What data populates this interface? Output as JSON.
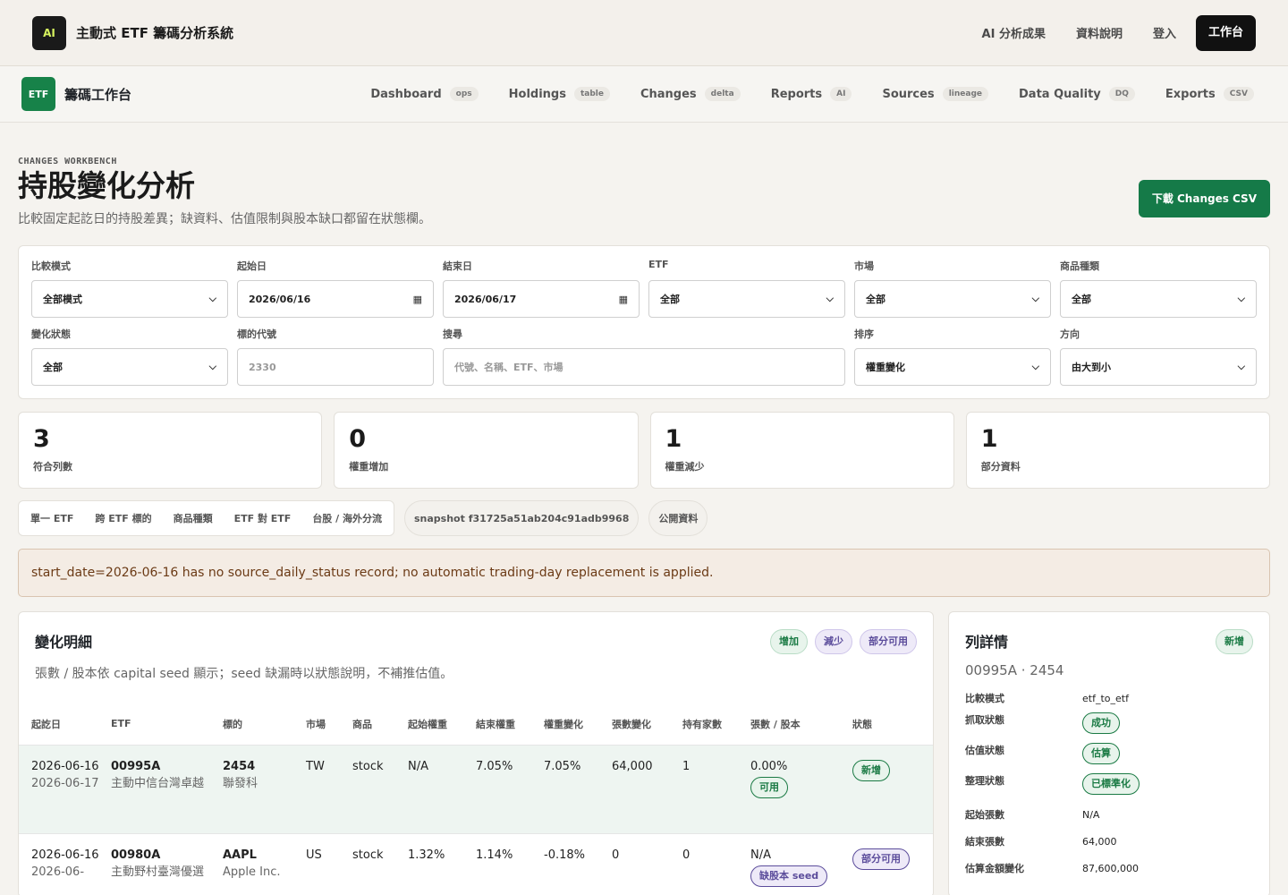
{
  "topbar": {
    "logo": "AI",
    "title": "主動式 ETF 籌碼分析系統",
    "links": [
      "AI 分析成果",
      "資料說明",
      "登入"
    ],
    "workspace_button": "工作台"
  },
  "subbar": {
    "logo": "ETF",
    "title": "籌碼工作台",
    "nav": [
      {
        "label": "Dashboard",
        "tag": "ops"
      },
      {
        "label": "Holdings",
        "tag": "table"
      },
      {
        "label": "Changes",
        "tag": "delta"
      },
      {
        "label": "Reports",
        "tag": "AI"
      },
      {
        "label": "Sources",
        "tag": "lineage"
      },
      {
        "label": "Data Quality",
        "tag": "DQ"
      },
      {
        "label": "Exports",
        "tag": "CSV"
      }
    ]
  },
  "header": {
    "eyebrow": "CHANGES WORKBENCH",
    "title": "持股變化分析",
    "description": "比較固定起訖日的持股差異；缺資料、估值限制與股本缺口都留在狀態欄。",
    "download_button": "下載 Changes CSV"
  },
  "filters": {
    "compare_mode": {
      "label": "比較模式",
      "value": "全部模式"
    },
    "start_date": {
      "label": "起始日",
      "value": "2026/06/16"
    },
    "end_date": {
      "label": "結束日",
      "value": "2026/06/17"
    },
    "etf": {
      "label": "ETF",
      "value": "全部"
    },
    "market": {
      "label": "市場",
      "value": "全部"
    },
    "product_type": {
      "label": "商品種類",
      "value": "全部"
    },
    "change_status": {
      "label": "變化狀態",
      "value": "全部"
    },
    "ticker": {
      "label": "標的代號",
      "placeholder": "2330"
    },
    "search": {
      "label": "搜尋",
      "placeholder": "代號、名稱、ETF、市場"
    },
    "sort": {
      "label": "排序",
      "value": "權重變化"
    },
    "direction": {
      "label": "方向",
      "value": "由大到小"
    }
  },
  "stats": [
    {
      "value": "3",
      "label": "符合列數"
    },
    {
      "value": "0",
      "label": "權重增加"
    },
    {
      "value": "1",
      "label": "權重減少"
    },
    {
      "value": "1",
      "label": "部分資料"
    }
  ],
  "mode_tabs": [
    "單一 ETF",
    "跨 ETF 標的",
    "商品種類",
    "ETF 對 ETF",
    "台股 / 海外分流"
  ],
  "snapshot_pill": "snapshot f31725a51ab204c91adb9968",
  "public_pill": "公開資料",
  "warning": "start_date=2026-06-16 has no source_daily_status record; no automatic trading-day replacement is applied.",
  "changes_panel": {
    "title": "變化明細",
    "description": "張數 / 股本依 capital seed 顯示；seed 缺漏時以狀態說明，不補推估值。",
    "badges": [
      "增加",
      "減少",
      "部分可用"
    ],
    "columns": [
      "起訖日",
      "ETF",
      "標的",
      "市場",
      "商品",
      "起始權重",
      "結束權重",
      "權重變化",
      "張數變化",
      "持有家數",
      "張數 / 股本",
      "狀態"
    ],
    "rows": [
      {
        "start": "2026-06-16",
        "end": "2026-06-17",
        "etf_code": "00995A",
        "etf_name": "主動中信台灣卓越",
        "ticker": "2454",
        "ticker_name": "聯發科",
        "market": "TW",
        "product": "stock",
        "start_weight": "N/A",
        "end_weight": "7.05%",
        "weight_change": "7.05%",
        "lot_change": "64,000",
        "holders": "1",
        "capital_ratio": "0.00%",
        "capital_badge": "可用",
        "status": "新增"
      },
      {
        "start": "2026-06-16",
        "end": "2026-06-",
        "etf_code": "00980A",
        "etf_name": "主動野村臺灣優選",
        "ticker": "AAPL",
        "ticker_name": "Apple Inc.",
        "market": "US",
        "product": "stock",
        "start_weight": "1.32%",
        "end_weight": "1.14%",
        "weight_change": "-0.18%",
        "lot_change": "0",
        "holders": "0",
        "capital_ratio": "N/A",
        "capital_badge": "缺股本 seed",
        "status": "部分可用"
      }
    ]
  },
  "detail_panel": {
    "title": "列詳情",
    "subtitle": "00995A · 2454",
    "badge": "新增",
    "fields": [
      {
        "key": "比較模式",
        "value": "etf_to_etf"
      },
      {
        "key": "抓取狀態",
        "badge": "成功"
      },
      {
        "key": "估值狀態",
        "badge": "估算"
      },
      {
        "key": "整理狀態",
        "badge": "已標準化"
      },
      {
        "key": "起始張數",
        "value": "N/A"
      },
      {
        "key": "結束張數",
        "value": "64,000"
      },
      {
        "key": "估算金額變化",
        "value": "87,600,000"
      }
    ]
  },
  "colors": {
    "brand_green": "#157a48",
    "accent_dark": "#111111",
    "warning_bg": "#f4ece4",
    "badge_green": "#1a7a44",
    "badge_purple": "#5b4c9b"
  }
}
